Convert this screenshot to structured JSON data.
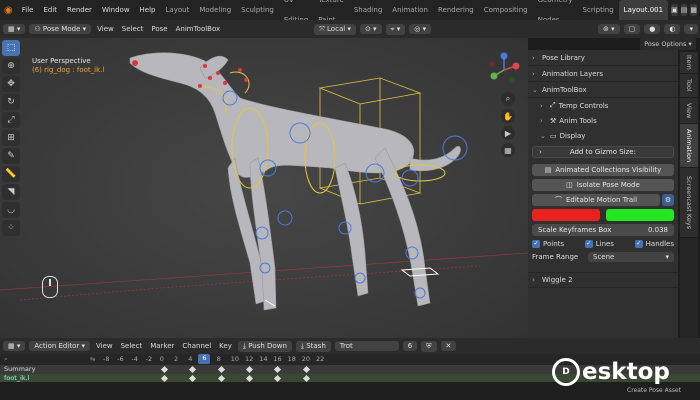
{
  "topbar": {
    "menus": [
      "File",
      "Edit",
      "Render",
      "Window",
      "Help"
    ],
    "workspaces": [
      "Layout",
      "Modeling",
      "Sculpting",
      "UV Editing",
      "Texture Paint",
      "Shading",
      "Animation",
      "Rendering",
      "Compositing",
      "Geometry Nodes",
      "Scripting",
      "Layout.001"
    ],
    "active_workspace": "Layout.001"
  },
  "header3d": {
    "mode": "Pose Mode",
    "menus": [
      "View",
      "Select",
      "Pose",
      "AnimToolBox"
    ],
    "transform_orientation": "Local",
    "pose_options": "Pose Options"
  },
  "viewport": {
    "perspective_label": "User Perspective",
    "object_label": "(6) rig_dog : foot_ik.l"
  },
  "sidepanel": {
    "pose_library": "Pose Library",
    "animation_layers": "Animation Layers",
    "animtoolbox": "AnimToolBox",
    "temp_controls": "Temp Controls",
    "anim_tools": "Anim Tools",
    "display": "Display",
    "add_to_gizmo": "Add to Gizmo Size:",
    "animated_collections": "Animated Collections Visibility",
    "isolate_pose": "Isolate Pose Mode",
    "editable_motion_trail": "Editable Motion Trail",
    "color_1": "#e8231d",
    "color_2": "#22e822",
    "scale_keyframes_label": "Scale Keyframes Box",
    "scale_keyframes_value": "0.038",
    "points": "Points",
    "lines": "Lines",
    "handles": "Handles",
    "frame_range_label": "Frame Range",
    "frame_range_value": "Scene",
    "wiggle": "Wiggle 2"
  },
  "vtabs": [
    "Item",
    "Tool",
    "View",
    "Animation",
    "Screencast Keys"
  ],
  "timeline": {
    "editor": "Action Editor",
    "menus": [
      "View",
      "Select",
      "Marker",
      "Channel",
      "Key"
    ],
    "push_down": "Push Down",
    "stash": "Stash",
    "action_name": "Trot",
    "users": "6",
    "ruler": [
      "-8",
      "-6",
      "-4",
      "-2",
      "0",
      "2",
      "4",
      "6",
      "8",
      "10",
      "12",
      "14",
      "16",
      "18",
      "20",
      "22"
    ],
    "current_frame": "6",
    "summary_label": "Summary",
    "channel_label": "foot_ik.l",
    "create_pose_asset": "Create Pose Asset"
  },
  "watermark": {
    "logo": "D",
    "text": "esktop"
  }
}
